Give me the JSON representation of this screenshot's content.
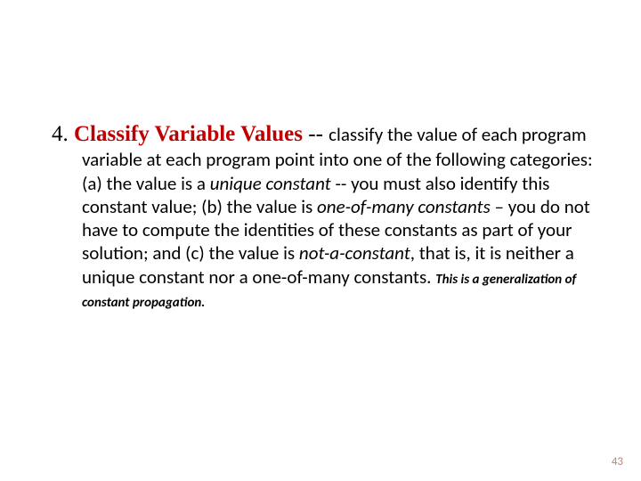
{
  "slide": {
    "number_prefix": "4. ",
    "title": "Classify Variable Values",
    "dashes": " -- ",
    "lead_in": "classify the value of each program variable at each program point into one of the following categories: (a) the value is a ",
    "term_a": "unique constant",
    "after_a": " -- you must also identify this constant value; (b) the value is ",
    "term_b": "one-of-many constants",
    "after_b": " – you do not have to compute the identities of these constants as part of your solution; and (c) the value is ",
    "term_c": "not-a-constant",
    "after_c": ", that is, it is neither a unique constant nor a one-of-many constants. ",
    "note": "This is a generalization of constant propagation."
  },
  "page_number": "43"
}
